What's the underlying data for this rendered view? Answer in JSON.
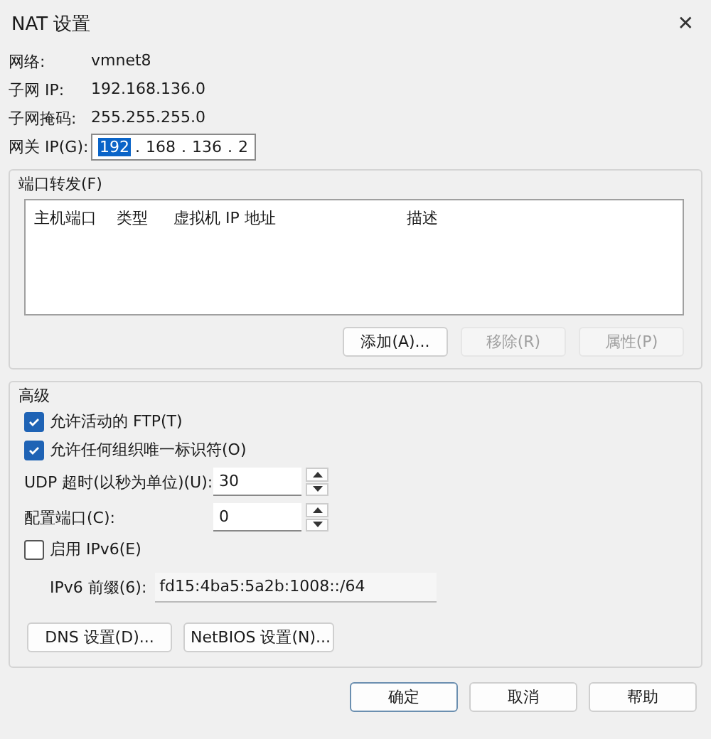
{
  "window": {
    "title": "NAT 设置",
    "close": "✕"
  },
  "info": [
    {
      "label": "网络:",
      "value": "vmnet8"
    },
    {
      "label": "子网 IP:",
      "value": "192.168.136.0"
    },
    {
      "label": "子网掩码:",
      "value": "255.255.255.0"
    }
  ],
  "gateway": {
    "label": "网关 IP(G):",
    "octets": [
      {
        "text": "192",
        "selected": true
      },
      {
        "text": "168",
        "selected": false
      },
      {
        "text": "136",
        "selected": false
      },
      {
        "text": "2",
        "selected": false
      }
    ],
    "dot": "."
  },
  "port_forwarding": {
    "title": "端口转发(F)",
    "columns": [
      "主机端口",
      "类型",
      "虚拟机 IP 地址",
      "描述"
    ],
    "buttons": [
      {
        "label": "添加(A)...",
        "disabled": false
      },
      {
        "label": "移除(R)",
        "disabled": true
      },
      {
        "label": "属性(P)",
        "disabled": true
      }
    ]
  },
  "advanced": {
    "title": "高级",
    "checkboxes": [
      {
        "label": "允许活动的 FTP(T)",
        "checked": true
      },
      {
        "label": "允许任何组织唯一标识符(O)",
        "checked": true
      }
    ],
    "spinners": [
      {
        "label": "UDP 超时(以秒为单位)(U):",
        "value": "30"
      },
      {
        "label": "配置端口(C):",
        "value": "0"
      }
    ],
    "ipv6": {
      "label": "启用 IPv6(E)",
      "checked": false
    },
    "prefix": {
      "label": "IPv6 前缀(6):",
      "value": "fd15:4ba5:5a2b:1008::/64"
    },
    "buttons": [
      {
        "label": "DNS 设置(D)..."
      },
      {
        "label": "NetBIOS 设置(N)..."
      }
    ]
  },
  "footer_buttons": [
    {
      "label": "确定",
      "default": true
    },
    {
      "label": "取消",
      "default": false
    },
    {
      "label": "帮助",
      "default": false
    }
  ]
}
